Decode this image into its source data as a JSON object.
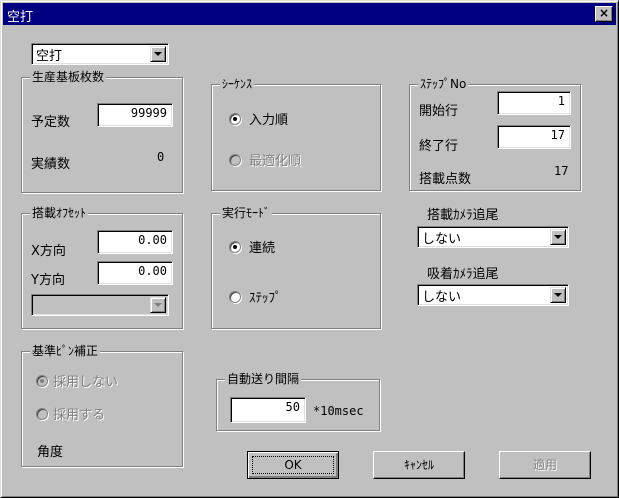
{
  "window": {
    "title": "空打",
    "close_symbol": "×"
  },
  "mode_combo": {
    "selected": "空打"
  },
  "production": {
    "title": "生産基板枚数",
    "planned_label": "予定数",
    "planned_value": "99999",
    "actual_label": "実績数",
    "actual_value": "0"
  },
  "offset": {
    "title": "搭載ｵﾌｾｯﾄ",
    "x_label": "X方向",
    "x_value": "0.00",
    "y_label": "Y方向",
    "y_value": "0.00"
  },
  "pin": {
    "title": "基準ﾋﾟﾝ補正",
    "not_use": "採用しない",
    "use": "採用する",
    "angle": "角度"
  },
  "sequence": {
    "title": "ｼｰｹﾝｽ",
    "input_order": "入力順",
    "optimized_order": "最適化順"
  },
  "exec_mode": {
    "title": "実行ﾓｰﾄﾞ",
    "continuous": "連続",
    "step": "ｽﾃｯﾌﾟ"
  },
  "auto_feed": {
    "title": "自動送り間隔",
    "value": "50",
    "unit": "*10msec"
  },
  "step_no": {
    "title": "ｽﾃｯﾌﾟNo",
    "start_label": "開始行",
    "start_value": "1",
    "end_label": "終了行",
    "end_value": "17",
    "count_label": "搭載点数",
    "count_value": "17"
  },
  "mount_camera": {
    "label": "搭載ｶﾒﾗ追尾",
    "selected": "しない"
  },
  "suction_camera": {
    "label": "吸着ｶﾒﾗ追尾",
    "selected": "しない"
  },
  "buttons": {
    "ok": "OK",
    "cancel": "ｷｬﾝｾﾙ",
    "apply": "適用"
  },
  "colors": {
    "titlebar": "#000080",
    "face": "#c0c0c0"
  }
}
